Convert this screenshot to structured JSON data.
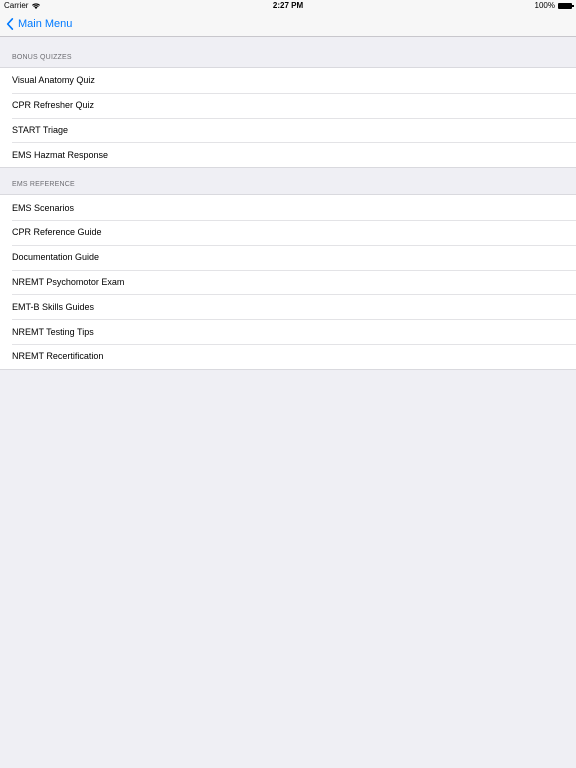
{
  "status_bar": {
    "carrier": "Carrier",
    "time": "2:27 PM",
    "battery": "100%"
  },
  "nav": {
    "back_label": "Main Menu"
  },
  "sections": [
    {
      "header": "BONUS QUIZZES",
      "items": [
        "Visual Anatomy Quiz",
        "CPR Refresher Quiz",
        "START Triage",
        "EMS Hazmat Response"
      ]
    },
    {
      "header": "EMS REFERENCE",
      "items": [
        "EMS Scenarios",
        "CPR Reference Guide",
        "Documentation Guide",
        "NREMT Psychomotor Exam",
        "EMT-B Skills Guides",
        "NREMT Testing Tips",
        "NREMT Recertification"
      ]
    }
  ],
  "colors": {
    "accent": "#007aff",
    "background": "#efeff4",
    "section_header_text": "#6d6d72"
  }
}
